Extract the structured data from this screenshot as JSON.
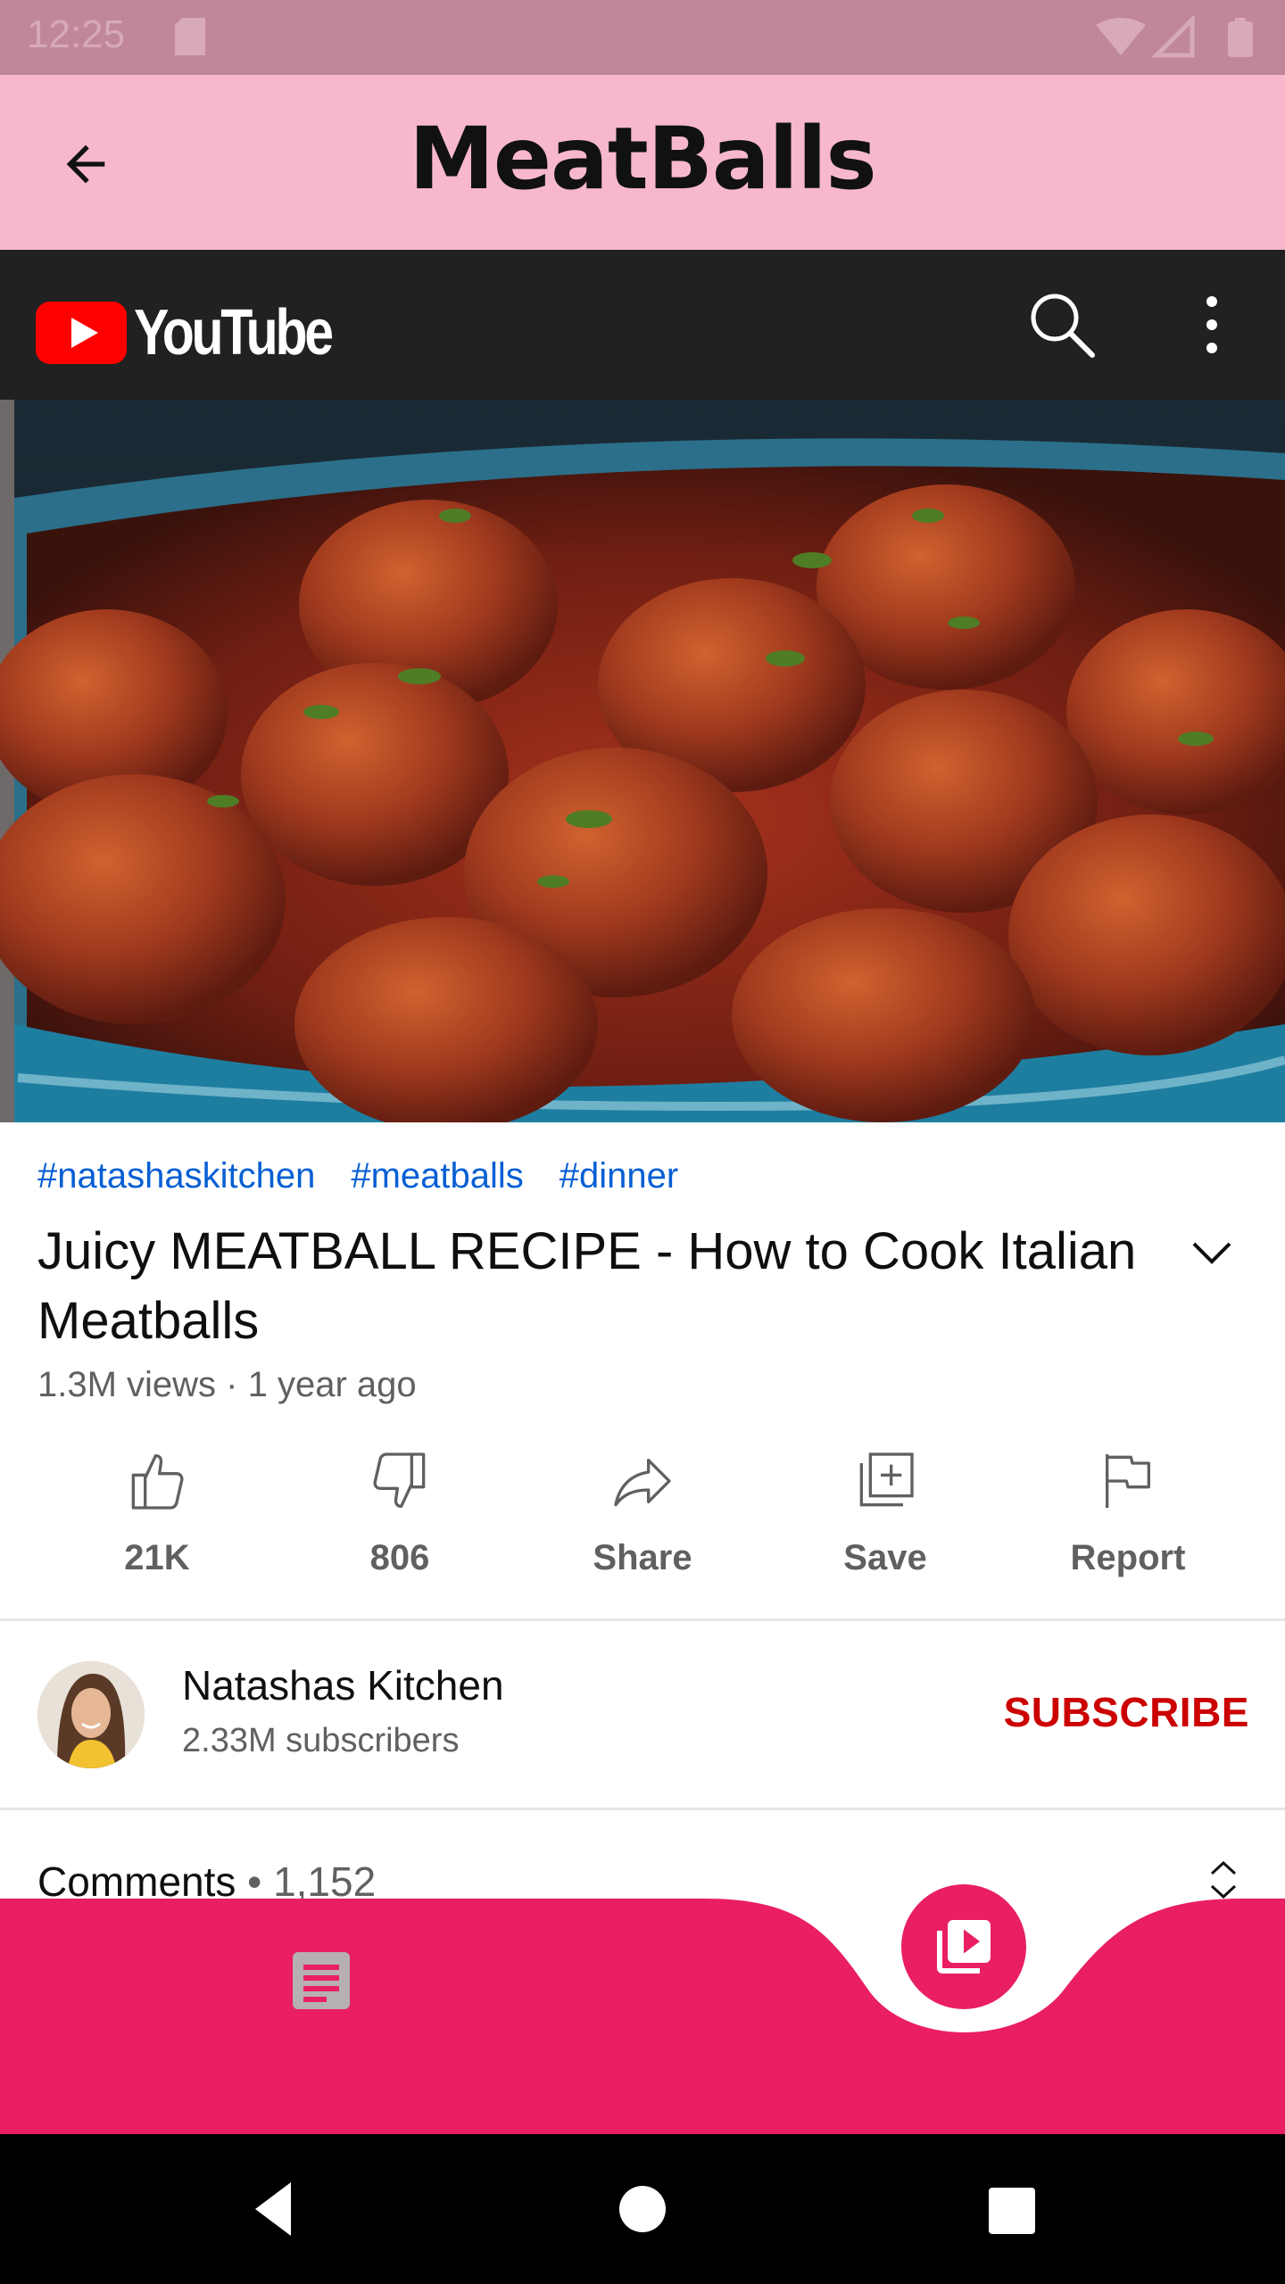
{
  "status_bar": {
    "time": "12:25"
  },
  "app_bar": {
    "title": "MeatBalls"
  },
  "youtube": {
    "wordmark": "YouTube"
  },
  "video": {
    "tags": [
      "#natashaskitchen",
      "#meatballs",
      "#dinner"
    ],
    "title": "Juicy MEATBALL RECIPE - How to Cook Italian Meatballs",
    "views": "1.3M views · 1 year ago",
    "actions": [
      {
        "label": "21K",
        "icon": "thumbs-up-icon"
      },
      {
        "label": "806",
        "icon": "thumbs-down-icon"
      },
      {
        "label": "Share",
        "icon": "share-icon"
      },
      {
        "label": "Save",
        "icon": "save-playlist-icon"
      },
      {
        "label": "Report",
        "icon": "flag-icon"
      }
    ]
  },
  "channel": {
    "name": "Natashas Kitchen",
    "subscribers": "2.33M subscribers",
    "subscribe_label": "SUBSCRIBE"
  },
  "comments": {
    "label": "Comments",
    "separator": " • ",
    "count": "1,152"
  },
  "colors": {
    "accent": "#e91e63",
    "app_bar": "#f7b8cf",
    "status_bar": "#c0879b",
    "youtube_red": "#ff0000",
    "link_blue": "#065fd4",
    "subscribe_red": "#cc0000"
  }
}
